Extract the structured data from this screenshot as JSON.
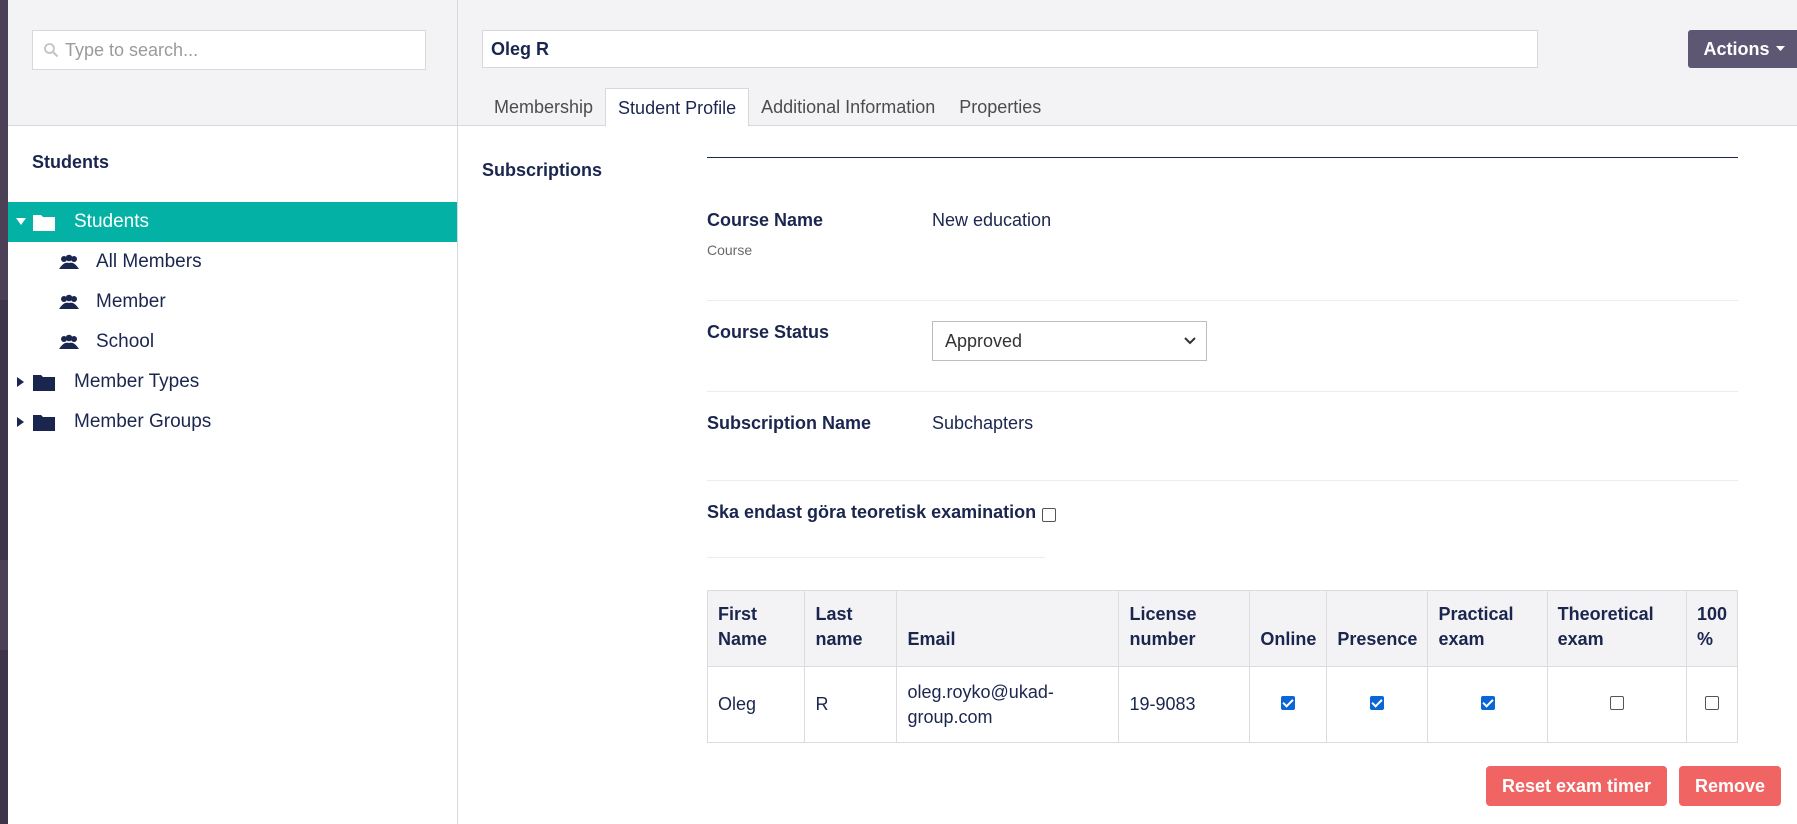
{
  "search": {
    "placeholder": "Type to search..."
  },
  "tree": {
    "title": "Students",
    "items": [
      {
        "label": "Students"
      },
      {
        "label": "All Members"
      },
      {
        "label": "Member"
      },
      {
        "label": "School"
      },
      {
        "label": "Member Types"
      },
      {
        "label": "Member Groups"
      }
    ]
  },
  "header": {
    "name_value": "Oleg R",
    "actions_label": "Actions"
  },
  "tabs": [
    {
      "label": "Membership"
    },
    {
      "label": "Student Profile"
    },
    {
      "label": "Additional Information"
    },
    {
      "label": "Properties"
    }
  ],
  "section": {
    "title": "Subscriptions"
  },
  "props": {
    "course_name": {
      "label": "Course Name",
      "desc": "Course",
      "value": "New education"
    },
    "course_status": {
      "label": "Course Status",
      "value": "Approved"
    },
    "subscription_name": {
      "label": "Subscription Name",
      "value": "Subchapters"
    },
    "theory_only": {
      "label": "Ska endast göra teoretisk examination",
      "checked": false
    }
  },
  "table": {
    "headers": [
      [
        "First",
        "Name"
      ],
      [
        "Last",
        "name"
      ],
      [
        "Email"
      ],
      [
        "License",
        "number"
      ],
      [
        "Online"
      ],
      [
        "Presence"
      ],
      [
        "Practical",
        "exam"
      ],
      [
        "Theoretical",
        "exam"
      ],
      [
        "100",
        "%"
      ]
    ],
    "rows": [
      {
        "first": "Oleg",
        "last": "R",
        "email_line1": "oleg.royko@ukad-",
        "email_line2": "group.com",
        "license": "19-9083",
        "online": true,
        "presence": true,
        "practical": true,
        "theoretical": false,
        "full": false
      }
    ]
  },
  "buttons": {
    "reset_label": "Reset exam timer",
    "remove_label": "Remove"
  },
  "colors": {
    "accent": "#03b2a5",
    "actions": "#5e5774",
    "danger": "#f06464",
    "text": "#1b264f"
  }
}
